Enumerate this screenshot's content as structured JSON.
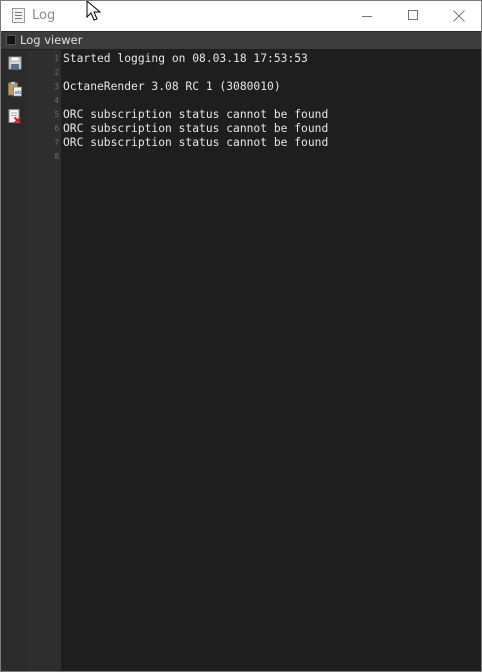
{
  "window": {
    "title": "Log",
    "icon": "log-document-icon",
    "controls": [
      "minimize-icon",
      "maximize-icon",
      "close-icon"
    ]
  },
  "panel": {
    "title": "Log viewer"
  },
  "toolbar": {
    "buttons": [
      {
        "name": "save-log-button",
        "icon": "floppy-disk-icon"
      },
      {
        "name": "copy-log-button",
        "icon": "clipboard-copy-icon"
      },
      {
        "name": "clear-log-button",
        "icon": "document-delete-icon"
      }
    ]
  },
  "log": {
    "lines": [
      {
        "number": "1",
        "text": "Started logging on 08.03.18 17:53:53"
      },
      {
        "number": "2",
        "text": ""
      },
      {
        "number": "3",
        "text": "OctaneRender 3.08 RC 1 (3080010)"
      },
      {
        "number": "4",
        "text": ""
      },
      {
        "number": "5",
        "text": "ORC subscription status cannot be found"
      },
      {
        "number": "6",
        "text": "ORC subscription status cannot be found"
      },
      {
        "number": "7",
        "text": "ORC subscription status cannot be found"
      },
      {
        "number": "8",
        "text": ""
      }
    ]
  },
  "colors": {
    "editor_background": "#1e1e1e",
    "gutter_background": "#2e2e2e",
    "text": "#e6e6e6",
    "line_number": "#6e6e6e"
  }
}
